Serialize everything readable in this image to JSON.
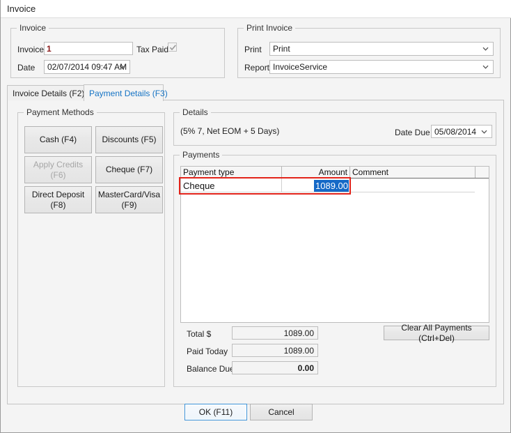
{
  "window": {
    "title": "Invoice"
  },
  "invoice_group": {
    "title": "Invoice",
    "invoice_label": "Invoice",
    "invoice_value": "1",
    "date_label": "Date",
    "date_value": "02/07/2014 09:47 AM",
    "tax_paid_label": "Tax Paid",
    "tax_paid_checked": "checked"
  },
  "print_group": {
    "title": "Print Invoice",
    "print_label": "Print",
    "print_value": "Print",
    "report_label": "Report",
    "report_value": "InvoiceService"
  },
  "tabs": [
    {
      "label": "Invoice Details (F2)",
      "active": "false"
    },
    {
      "label": "Payment Details (F3)",
      "active": "true"
    }
  ],
  "payment_methods": {
    "title": "Payment Methods",
    "buttons": [
      {
        "label": "Cash (F4)",
        "disabled": "false"
      },
      {
        "label": "Discounts (F5)",
        "disabled": "false"
      },
      {
        "label": "Apply Credits\n(F6)",
        "disabled": "true"
      },
      {
        "label": "Cheque (F7)",
        "disabled": "false"
      },
      {
        "label": "Direct Deposit\n(F8)",
        "disabled": "false"
      },
      {
        "label": "MasterCard/Visa\n(F9)",
        "disabled": "false"
      }
    ]
  },
  "details": {
    "title": "Details",
    "terms_text": "(5% 7, Net EOM + 5 Days)",
    "date_due_label": "Date Due",
    "date_due_value": "05/08/2014"
  },
  "payments": {
    "title": "Payments",
    "columns": [
      "Payment type",
      "Amount",
      "Comment"
    ],
    "rows": [
      {
        "payment_type": "Cheque",
        "amount": "1089.00",
        "comment": ""
      }
    ],
    "selected_amount": "1089.00"
  },
  "totals": {
    "total_label": "Total $",
    "total_value": "1089.00",
    "paid_today_label": "Paid Today",
    "paid_today_value": "1089.00",
    "balance_due_label": "Balance Due",
    "balance_due_value": "0.00",
    "clear_all_label": "Clear All Payments (Ctrl+Del)"
  },
  "footer": {
    "ok_label": "OK (F11)",
    "cancel_label": "Cancel"
  },
  "colors": {
    "accent": "#1573c4",
    "selection": "#1569c7",
    "invoice_number": "#8b1a1a",
    "annotation": "#e2231a"
  }
}
